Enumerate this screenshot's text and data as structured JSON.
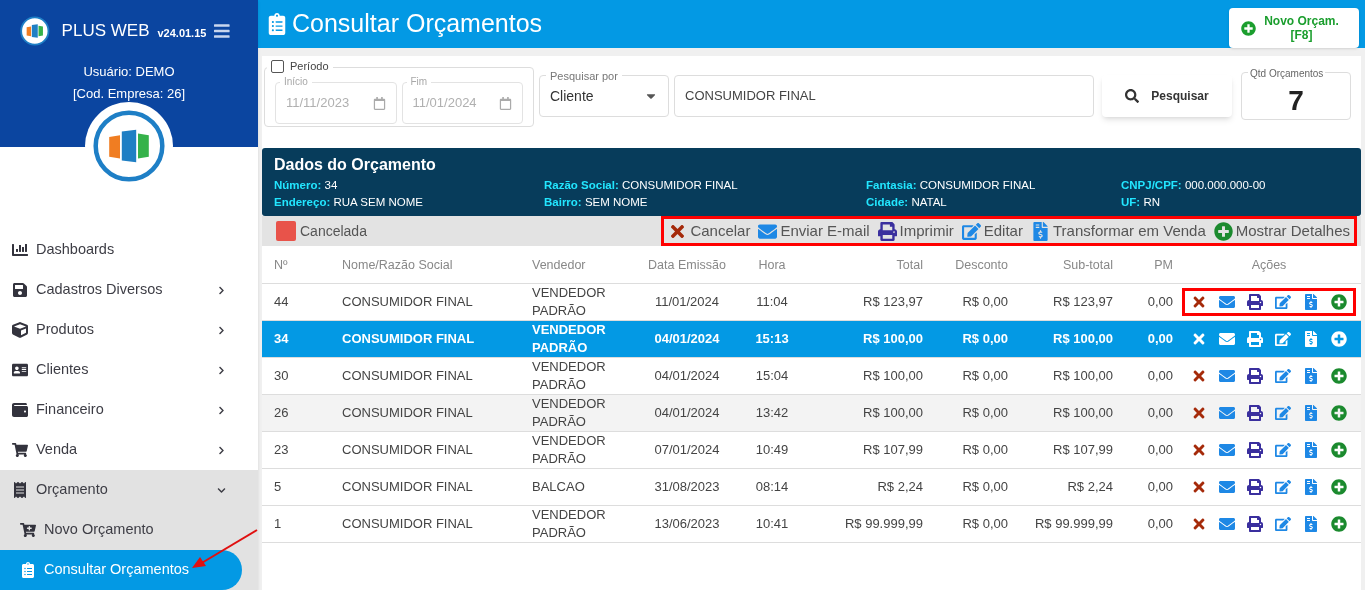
{
  "sidebar": {
    "app_name": "PLUS WEB",
    "version": "v24.01.15",
    "user": "Usuário: DEMO",
    "company": "[Cod. Empresa: 26]",
    "items": [
      {
        "kind": "dashboard",
        "label": "Dashboards"
      },
      {
        "kind": "save",
        "label": "Cadastros Diversos",
        "expanded": false
      },
      {
        "kind": "box",
        "label": "Produtos",
        "expanded": false
      },
      {
        "kind": "card",
        "label": "Clientes",
        "expanded": false
      },
      {
        "kind": "wallet",
        "label": "Financeiro",
        "expanded": false
      },
      {
        "kind": "cart",
        "label": "Venda",
        "expanded": false
      },
      {
        "kind": "receipt",
        "label": "Orçamento",
        "expanded": true,
        "children": [
          {
            "kind": "cartplus",
            "label": "Novo Orçamento",
            "selected": false
          },
          {
            "kind": "clipboard",
            "label": "Consultar Orçamentos",
            "selected": true,
            "pointed": true
          }
        ]
      }
    ]
  },
  "header": {
    "title": "Consultar Orçamentos",
    "new_button": [
      "Novo Orçam.",
      "[F8]"
    ]
  },
  "filters": {
    "period": {
      "label": "Período",
      "checked": false,
      "start": {
        "label": "Início",
        "value": "11/11/2023",
        "disabled": true
      },
      "end": {
        "label": "Fim",
        "value": "11/01/2024",
        "disabled": true
      }
    },
    "search_by": {
      "label": "Pesquisar por",
      "value": "Cliente"
    },
    "query": "CONSUMIDOR FINAL",
    "search_button": "Pesquisar",
    "count": {
      "label": "Qtd Orçamentos",
      "value": "7"
    }
  },
  "details": {
    "title": "Dados do Orçamento",
    "fields": [
      {
        "label": "Número:",
        "value": "34"
      },
      {
        "label": "Razão Social:",
        "value": "CONSUMIDOR FINAL"
      },
      {
        "label": "Fantasia:",
        "value": "CONSUMIDOR FINAL"
      },
      {
        "label": "CNPJ/CPF:",
        "value": "000.000.000-00"
      },
      {
        "label": "Endereço:",
        "value": "RUA SEM NOME"
      },
      {
        "label": "Bairro:",
        "value": "SEM NOME"
      },
      {
        "label": "Cidade:",
        "value": "NATAL"
      },
      {
        "label": "UF:",
        "value": "RN"
      }
    ]
  },
  "legend": {
    "label": "Cancelada",
    "color": "#e8534a"
  },
  "toolbar": {
    "highlighted": true,
    "actions": [
      {
        "kind": "cancel",
        "label": "Cancelar"
      },
      {
        "kind": "email",
        "label": "Enviar E-mail"
      },
      {
        "kind": "print",
        "label": "Imprimir"
      },
      {
        "kind": "edit",
        "label": "Editar"
      },
      {
        "kind": "sale",
        "label": "Transformar em Venda"
      },
      {
        "kind": "details",
        "label": "Mostrar Detalhes"
      }
    ]
  },
  "table": {
    "columns": [
      "Nº",
      "Nome/Razão Social",
      "Vendedor",
      "Data Emissão",
      "Hora",
      "Total",
      "Desconto",
      "Sub-total",
      "PM",
      "Ações"
    ],
    "rows": [
      {
        "cells": [
          "44",
          "CONSUMIDOR FINAL",
          "VENDEDOR PADRÃO",
          "11/01/2024",
          "11:04",
          "R$ 123,97",
          "R$ 0,00",
          "R$ 123,97",
          "0,00"
        ],
        "selected": false,
        "hover": false,
        "highlighted": true
      },
      {
        "cells": [
          "34",
          "CONSUMIDOR FINAL",
          "VENDEDOR PADRÃO",
          "04/01/2024",
          "15:13",
          "R$ 100,00",
          "R$ 0,00",
          "R$ 100,00",
          "0,00"
        ],
        "selected": true,
        "hover": false,
        "highlighted": false
      },
      {
        "cells": [
          "30",
          "CONSUMIDOR FINAL",
          "VENDEDOR PADRÃO",
          "04/01/2024",
          "15:04",
          "R$ 100,00",
          "R$ 0,00",
          "R$ 100,00",
          "0,00"
        ],
        "selected": false,
        "hover": false,
        "highlighted": false
      },
      {
        "cells": [
          "26",
          "CONSUMIDOR FINAL",
          "VENDEDOR PADRÃO",
          "04/01/2024",
          "13:42",
          "R$ 100,00",
          "R$ 0,00",
          "R$ 100,00",
          "0,00"
        ],
        "selected": false,
        "hover": true,
        "highlighted": false
      },
      {
        "cells": [
          "23",
          "CONSUMIDOR FINAL",
          "VENDEDOR PADRÃO",
          "07/01/2024",
          "10:49",
          "R$ 107,99",
          "R$ 0,00",
          "R$ 107,99",
          "0,00"
        ],
        "selected": false,
        "hover": false,
        "highlighted": false
      },
      {
        "cells": [
          "5",
          "CONSUMIDOR FINAL",
          "BALCAO",
          "31/08/2023",
          "08:14",
          "R$ 2,24",
          "R$ 0,00",
          "R$ 2,24",
          "0,00"
        ],
        "selected": false,
        "hover": false,
        "highlighted": false
      },
      {
        "cells": [
          "1",
          "CONSUMIDOR FINAL",
          "VENDEDOR PADRÃO",
          "13/06/2023",
          "10:41",
          "R$ 99.999,99",
          "R$ 0,00",
          "R$ 99.999,99",
          "0,00"
        ],
        "selected": false,
        "hover": false,
        "highlighted": false
      }
    ]
  }
}
